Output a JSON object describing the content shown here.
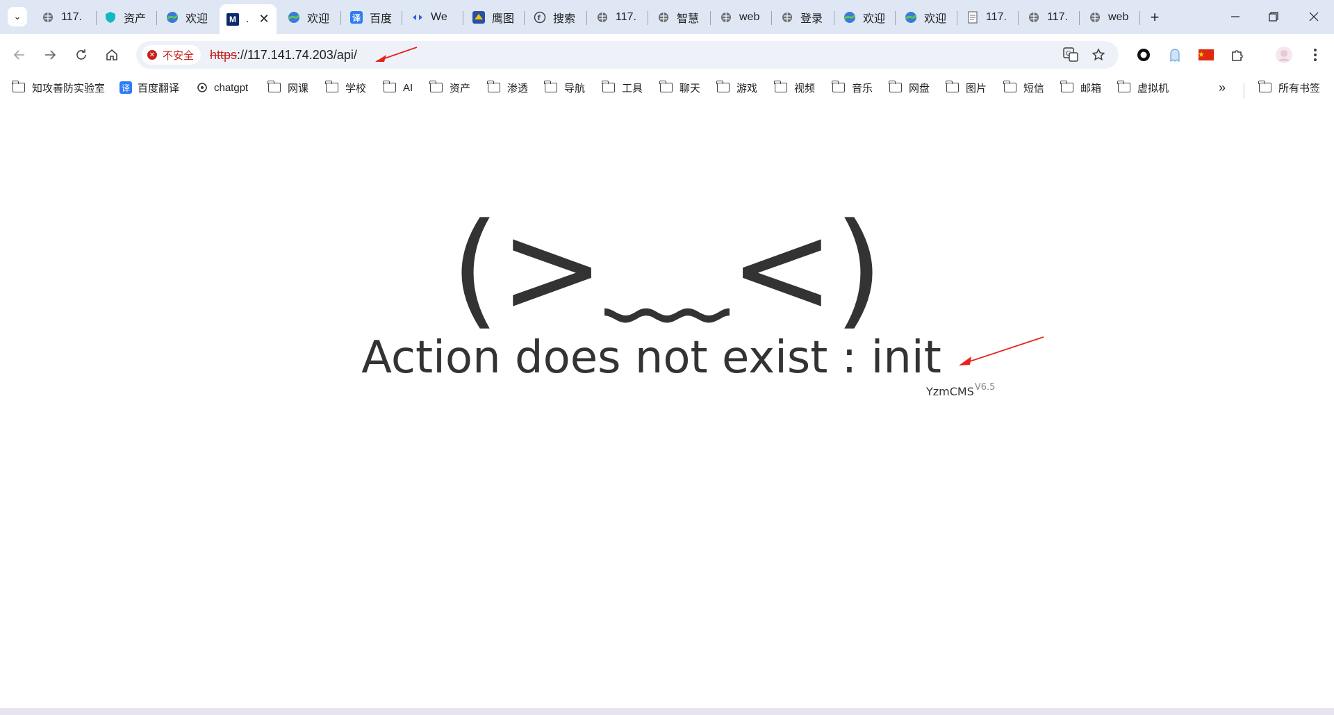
{
  "tabs": [
    {
      "title": "117.",
      "icon": "globe-icon"
    },
    {
      "title": "资产",
      "icon": "shield-icon"
    },
    {
      "title": "欢迎",
      "icon": "globe-leaf-icon"
    },
    {
      "title": ".",
      "icon": "m-logo-icon",
      "active": true
    },
    {
      "title": "欢迎",
      "icon": "globe-leaf-icon"
    },
    {
      "title": "百度",
      "icon": "translate-icon"
    },
    {
      "title": "We",
      "icon": "meta-icon"
    },
    {
      "title": "鹰图",
      "icon": "eagle-icon"
    },
    {
      "title": "搜索",
      "icon": "fofa-icon"
    },
    {
      "title": "117.",
      "icon": "globe-icon"
    },
    {
      "title": "智慧",
      "icon": "globe-icon"
    },
    {
      "title": "web",
      "icon": "globe-icon"
    },
    {
      "title": "登录",
      "icon": "globe-icon"
    },
    {
      "title": "欢迎",
      "icon": "globe-leaf-icon"
    },
    {
      "title": "欢迎",
      "icon": "globe-leaf-icon"
    },
    {
      "title": "117.",
      "icon": "doc-icon"
    },
    {
      "title": "117.",
      "icon": "globe-icon"
    },
    {
      "title": "web",
      "icon": "globe-icon"
    }
  ],
  "omnibox": {
    "security_label": "不安全",
    "url_protocol": "https",
    "url_rest": "://117.141.74.203/api/"
  },
  "bookmarks": [
    {
      "label": "知攻善防实验室",
      "type": "folder"
    },
    {
      "label": "百度翻译",
      "type": "site"
    },
    {
      "label": "chatgpt",
      "type": "site"
    },
    {
      "label": "网课",
      "type": "folder"
    },
    {
      "label": "学校",
      "type": "folder"
    },
    {
      "label": "AI",
      "type": "folder"
    },
    {
      "label": "资产",
      "type": "folder"
    },
    {
      "label": "渗透",
      "type": "folder"
    },
    {
      "label": "导航",
      "type": "folder"
    },
    {
      "label": "工具",
      "type": "folder"
    },
    {
      "label": "聊天",
      "type": "folder"
    },
    {
      "label": "游戏",
      "type": "folder"
    },
    {
      "label": "视频",
      "type": "folder"
    },
    {
      "label": "音乐",
      "type": "folder"
    },
    {
      "label": "网盘",
      "type": "folder"
    },
    {
      "label": "图片",
      "type": "folder"
    },
    {
      "label": "短信",
      "type": "folder"
    },
    {
      "label": "邮箱",
      "type": "folder"
    },
    {
      "label": "虚拟机",
      "type": "folder"
    }
  ],
  "all_bookmarks_label": "所有书签",
  "page": {
    "face": "(>﹏<)",
    "message": "Action does not exist : init",
    "brand": "YzmCMS",
    "version": "V6.5"
  },
  "colors": {
    "annotation_arrow": "#e8231b",
    "insecure": "#c5221f",
    "text": "#333333"
  }
}
